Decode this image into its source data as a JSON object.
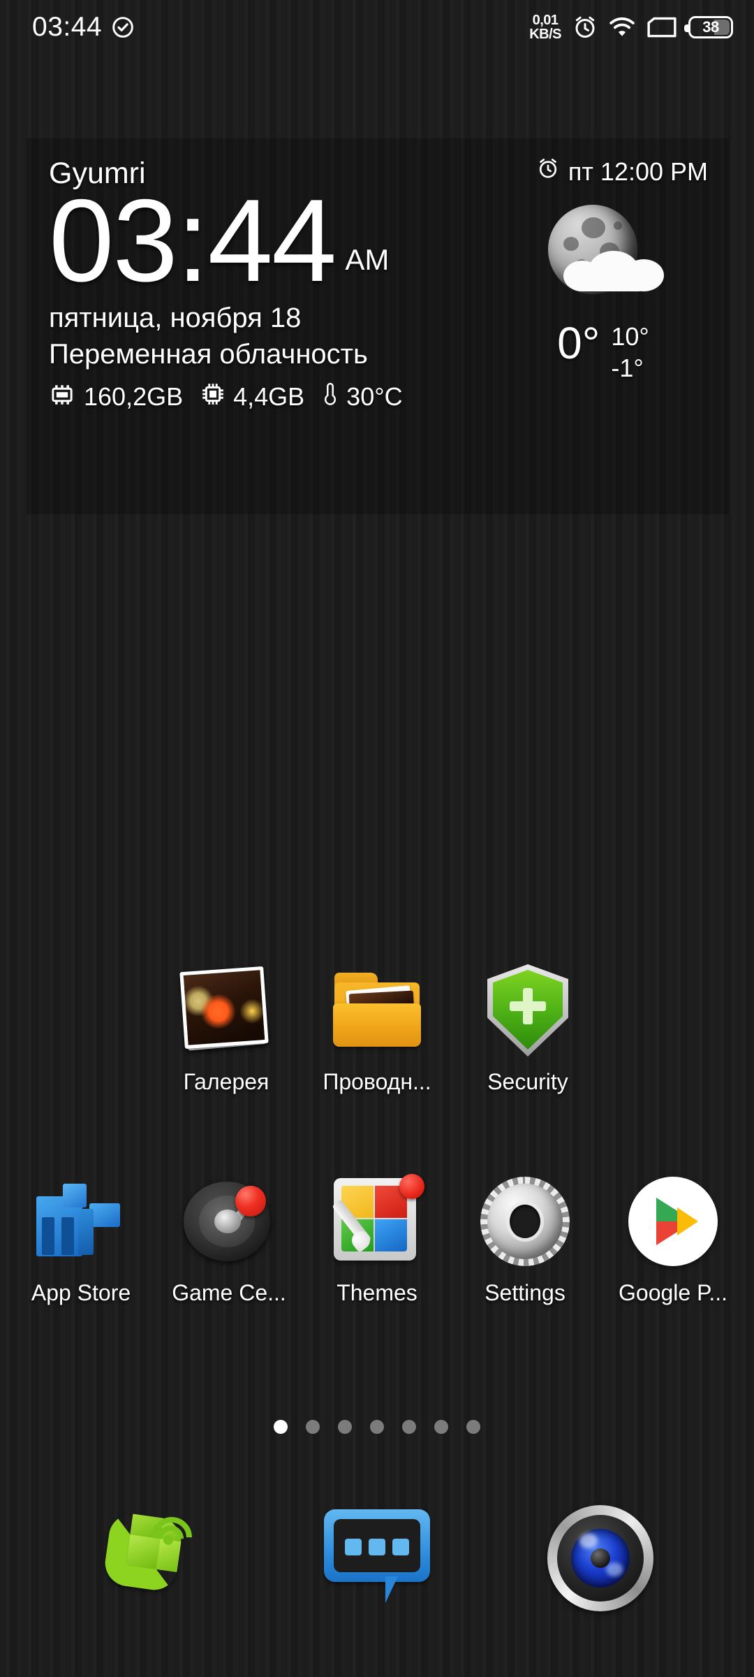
{
  "status_bar": {
    "clock": "03:44",
    "check_icon": "check-circle-icon",
    "network_speed_value": "0,01",
    "network_speed_unit": "KB/S",
    "alarm_icon": "alarm-clock-icon",
    "wifi_icon": "wifi-icon",
    "sim_icon": "sim-card-icon",
    "battery_level": "38"
  },
  "widget": {
    "city": "Gyumri",
    "alarm_icon": "alarm-clock-icon",
    "alarm_time": "пт 12:00 PM",
    "time": "03:44",
    "meridiem": "AM",
    "date": "пятница, ноября 18",
    "condition": "Переменная облачность",
    "weather_icon": "moon-behind-cloud-icon",
    "temp_current": "0°",
    "temp_high": "10°",
    "temp_low": "-1°",
    "stats": [
      {
        "icon": "storage-chip-icon",
        "value": "160,2GB"
      },
      {
        "icon": "cpu-chip-icon",
        "value": "4,4GB"
      },
      {
        "icon": "thermometer-icon",
        "value": "30°C"
      }
    ]
  },
  "apps": {
    "row1": [
      {
        "label": "Галерея",
        "icon": "gallery-icon"
      },
      {
        "label": "Проводн...",
        "icon": "file-explorer-icon"
      },
      {
        "label": "Security",
        "icon": "security-shield-icon"
      }
    ],
    "row2": [
      {
        "label": "App Store",
        "icon": "mi-app-store-icon"
      },
      {
        "label": "Game Ce...",
        "icon": "game-center-joystick-icon"
      },
      {
        "label": "Themes",
        "icon": "themes-icon",
        "badge": true
      },
      {
        "label": "Settings",
        "icon": "settings-gear-icon"
      },
      {
        "label": "Google P...",
        "icon": "google-play-icon"
      }
    ]
  },
  "pager": {
    "total": 7,
    "active_index": 0
  },
  "dock": [
    {
      "label": "phone",
      "icon": "phone-dialer-icon"
    },
    {
      "label": "messaging",
      "icon": "sms-messaging-icon"
    },
    {
      "label": "camera",
      "icon": "camera-lens-icon"
    }
  ],
  "colors": {
    "wallpaper": "#1d1d1d",
    "widget_panel": "rgba(10,10,10,0.32)",
    "text": "#ffffff",
    "dot_active": "#ffffff",
    "dot_inactive": "#7c7c7c",
    "security_green": "#4caf17",
    "folder_orange": "#f7b728",
    "store_blue": "#2076cf",
    "badge_red": "#e8261a",
    "phone_green": "#8cd41f",
    "sms_blue": "#2f8ede"
  }
}
